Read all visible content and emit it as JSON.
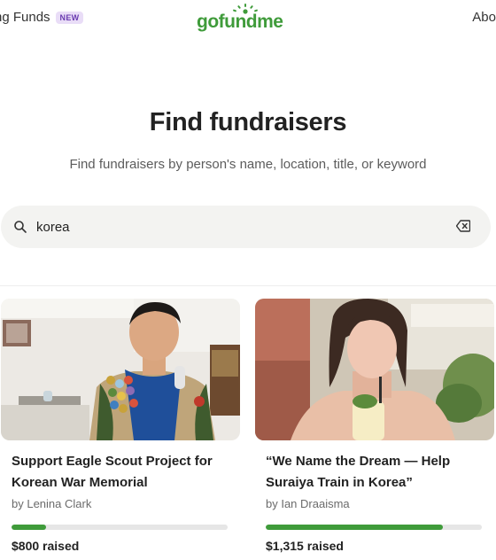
{
  "nav": {
    "left_label": "ng Funds",
    "left_badge": "NEW",
    "logo_text": "gofundme",
    "right_label": "Abo"
  },
  "hero": {
    "title": "Find fundraisers",
    "subtitle": "Find fundraisers by person's name, location, title, or keyword"
  },
  "search": {
    "value": "korea",
    "icon": "search-icon",
    "clear_icon": "clear-icon"
  },
  "colors": {
    "brand": "#3f9b3a",
    "search_bg": "#f3f3f1",
    "badge_bg": "#e9ddf7",
    "badge_text": "#6a3bb0"
  },
  "results": [
    {
      "title_line1": "Support Eagle Scout Project for",
      "title_line2": "Korean War Memorial",
      "author": "by Lenina Clark",
      "progress": 0.16,
      "raised": "$800 raised"
    },
    {
      "title_line1": "“We Name the Dream — Help",
      "title_line2": "Suraiya Train in Korea”",
      "author": "by Ian Draaisma",
      "progress": 0.82,
      "raised": "$1,315 raised"
    }
  ]
}
